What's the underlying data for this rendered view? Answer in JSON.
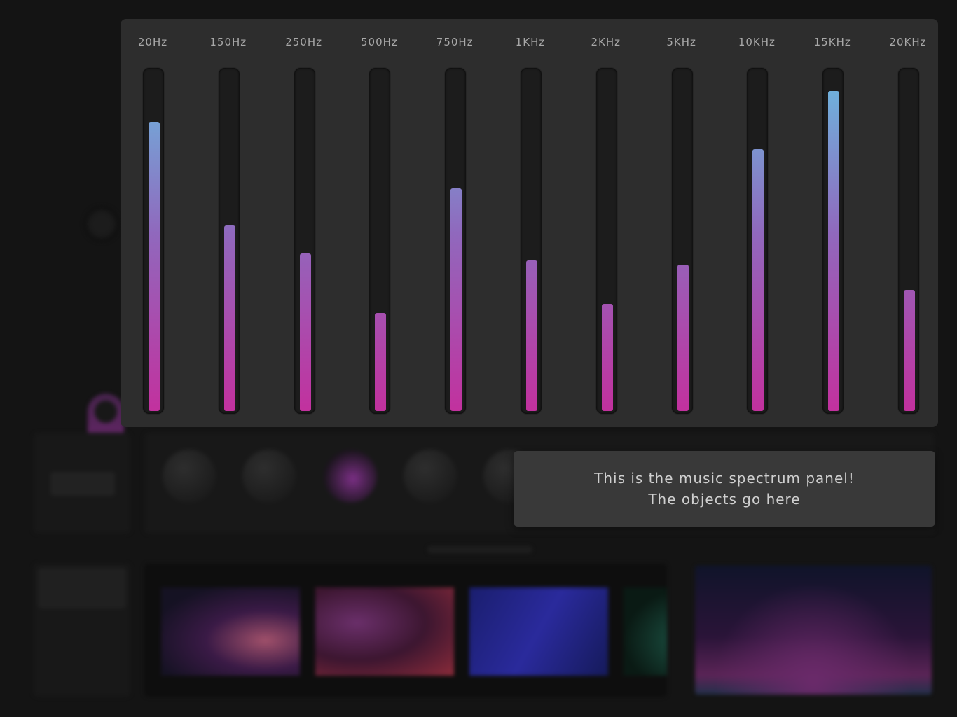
{
  "spectrum": {
    "bands": [
      {
        "label": "20Hz",
        "level": 0.85
      },
      {
        "label": "150Hz",
        "level": 0.545
      },
      {
        "label": "250Hz",
        "level": 0.463
      },
      {
        "label": "500Hz",
        "level": 0.288
      },
      {
        "label": "750Hz",
        "level": 0.654
      },
      {
        "label": "1KHz",
        "level": 0.443
      },
      {
        "label": "2KHz",
        "level": 0.315
      },
      {
        "label": "5KHz",
        "level": 0.43
      },
      {
        "label": "10KHz",
        "level": 0.77
      },
      {
        "label": "15KHz",
        "level": 0.94
      },
      {
        "label": "20KHz",
        "level": 0.355
      }
    ],
    "colors": {
      "bottom": "#c2319e",
      "middle": "#9068bd",
      "top": "#6fb1dc"
    }
  },
  "tooltip": {
    "line1": "This is the music spectrum panel!",
    "line2": "The objects go here"
  },
  "effects": {
    "knobs": [
      "knob-1",
      "knob-2",
      "knob-3-accent",
      "knob-4",
      "knob-5"
    ]
  }
}
